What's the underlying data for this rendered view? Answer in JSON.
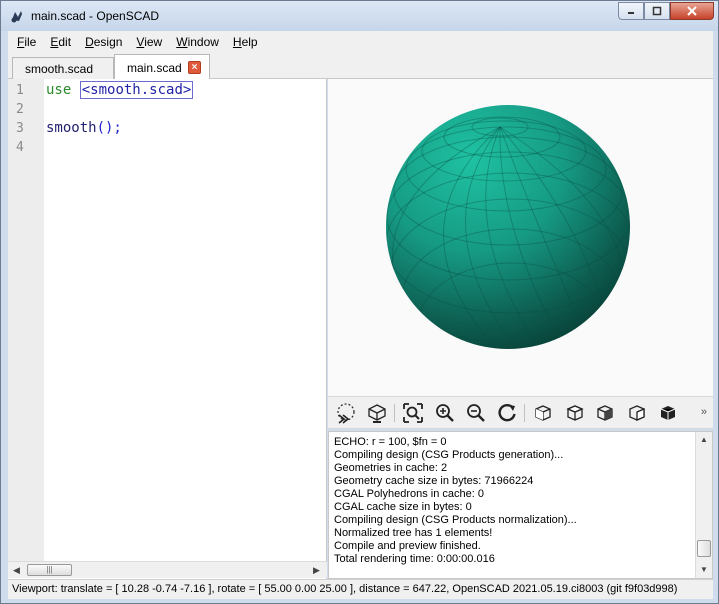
{
  "window": {
    "title": "main.scad - OpenSCAD"
  },
  "menu": [
    {
      "label": "File",
      "key": "F",
      "rest": "ile"
    },
    {
      "label": "Edit",
      "key": "E",
      "rest": "dit"
    },
    {
      "label": "Design",
      "key": "D",
      "rest": "esign"
    },
    {
      "label": "View",
      "key": "V",
      "rest": "iew"
    },
    {
      "label": "Window",
      "key": "W",
      "rest": "indow"
    },
    {
      "label": "Help",
      "key": "H",
      "rest": "elp"
    }
  ],
  "tabs": [
    {
      "label": "smooth.scad",
      "active": false
    },
    {
      "label": "main.scad",
      "active": true
    }
  ],
  "editor": {
    "line_numbers": [
      "1",
      "2",
      "3",
      "4"
    ],
    "line1_keyword": "use",
    "line1_include": "<smooth.scad>",
    "line3_fn": "smooth",
    "line3_rest": "();"
  },
  "viewer": {
    "object": "sphere",
    "color": "#1fa994"
  },
  "toolbar": {
    "buttons": [
      "preview",
      "render",
      "view-all",
      "zoom-in",
      "zoom-out",
      "reset-view",
      "view-right",
      "view-top",
      "view-bottom",
      "view-left",
      "view-front"
    ],
    "more": "»"
  },
  "console": {
    "lines": [
      "ECHO: r = 100, $fn = 0",
      "Compiling design (CSG Products generation)...",
      "Geometries in cache: 2",
      "Geometry cache size in bytes: 71966224",
      "CGAL Polyhedrons in cache: 0",
      "CGAL cache size in bytes: 0",
      "Compiling design (CSG Products normalization)...",
      "Normalized tree has 1 elements!",
      "Compile and preview finished.",
      "Total rendering time: 0:00:00.016"
    ]
  },
  "status": {
    "text": "Viewport: translate = [ 10.28 -0.74 -7.16 ], rotate = [ 55.00 0.00 25.00 ], distance = 647.22, OpenSCAD 2021.05.19.ci8003 (git f9f03d998)"
  }
}
